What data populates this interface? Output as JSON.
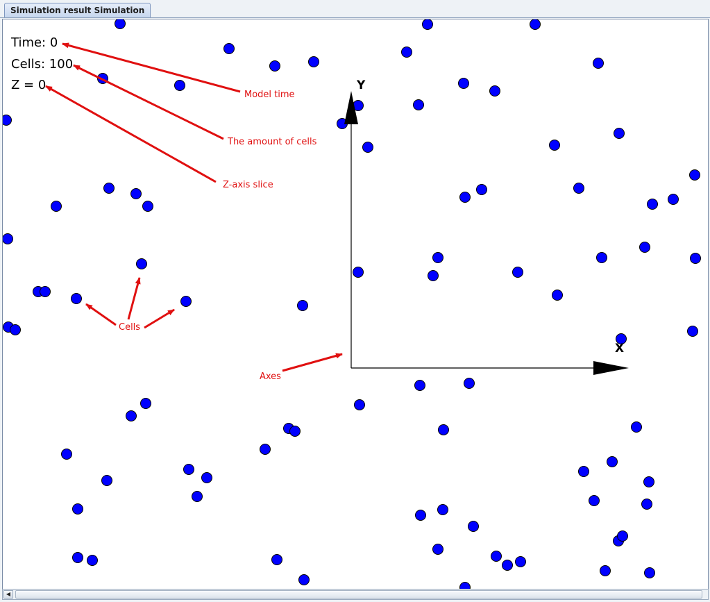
{
  "window": {
    "tab_label": "Simulation result Simulation"
  },
  "info": {
    "time_label": "Time: 0",
    "cells_label": "Cells: 100",
    "z_label": "Z = 0"
  },
  "annotations": {
    "model_time": "Model time",
    "amount_of_cells": "The amount of cells",
    "z_axis_slice": "Z-axis slice",
    "cells": "Cells",
    "axes": "Axes"
  },
  "axes": {
    "x_label": "X",
    "y_label": "Y"
  },
  "colors": {
    "cell_fill": "#0000ff",
    "cell_stroke": "#000000",
    "annotation": "#e01010"
  },
  "cell_count_shown": 100
}
